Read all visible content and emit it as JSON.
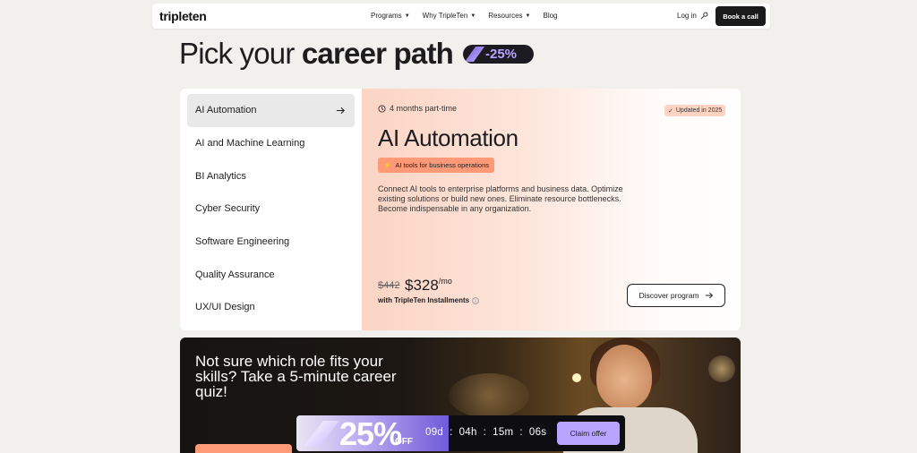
{
  "header": {
    "logo": "tripleten",
    "nav": [
      {
        "label": "Programs",
        "has_dropdown": true
      },
      {
        "label": "Why TripleTen",
        "has_dropdown": true
      },
      {
        "label": "Resources",
        "has_dropdown": true
      },
      {
        "label": "Blog",
        "has_dropdown": false
      }
    ],
    "login_label": "Log in",
    "login_icon": "key-icon",
    "cta_label": "Book a call"
  },
  "hero": {
    "title_light": "Pick your ",
    "title_bold": "career path",
    "discount_badge": "-25%"
  },
  "sidebar": {
    "items": [
      {
        "label": "AI Automation",
        "active": true
      },
      {
        "label": "AI and Machine Learning",
        "active": false
      },
      {
        "label": "BI Analytics",
        "active": false
      },
      {
        "label": "Cyber Security",
        "active": false
      },
      {
        "label": "Software Engineering",
        "active": false
      },
      {
        "label": "Quality Assurance",
        "active": false
      },
      {
        "label": "UX/UI Design",
        "active": false
      }
    ]
  },
  "program": {
    "duration": "4 months part-time",
    "updated_badge": "Updated in 2025",
    "title": "AI Automation",
    "tag": "AI tools for business operations",
    "description": "Connect AI tools to enterprise platforms and business data. Optimize existing solutions or build new ones. Eliminate resource bottlenecks. Become indispensable in any organization.",
    "old_price": "$442",
    "new_price": "$328",
    "price_unit": "/mo",
    "installments": "with TripleTen Installments",
    "discover_label": "Discover program"
  },
  "quiz": {
    "title": "Not sure which role fits your skills? Take a 5-minute career quiz!"
  },
  "promo": {
    "percent": "25%",
    "off": "OFF",
    "countdown": "09d  :  04h  :  15m  :  06s",
    "claim_label": "Claim offer"
  },
  "colors": {
    "accent": "#ff9a78",
    "purple": "#b9a5ff",
    "dark": "#1b1b1b"
  }
}
